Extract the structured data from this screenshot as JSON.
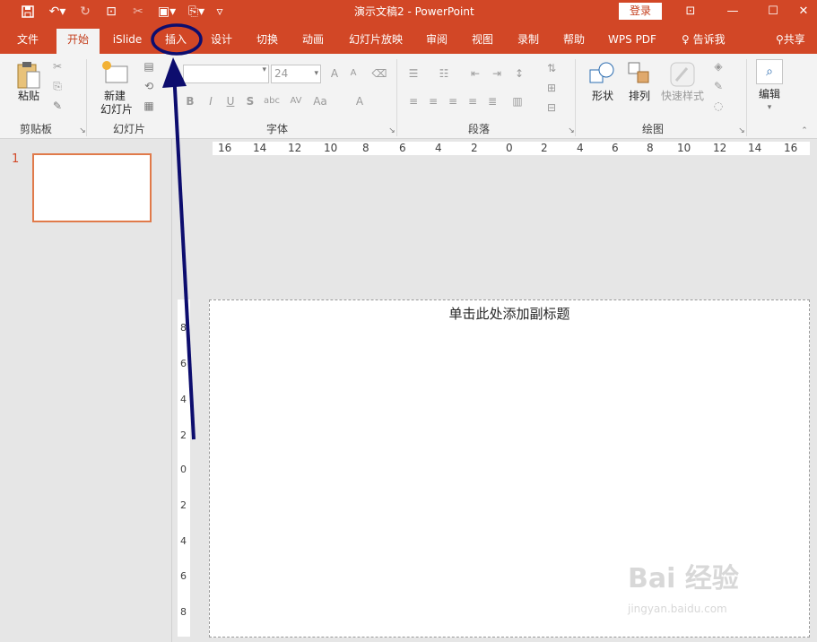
{
  "window": {
    "title": "演示文稿2 - PowerPoint",
    "login_label": "登录"
  },
  "qat": {
    "save_icon": "save-icon",
    "undo_icon": "undo-icon",
    "redo_icon": "redo-icon"
  },
  "tabs": [
    {
      "label": "文件"
    },
    {
      "label": "开始"
    },
    {
      "label": "iSlide"
    },
    {
      "label": "插入"
    },
    {
      "label": "设计"
    },
    {
      "label": "切换"
    },
    {
      "label": "动画"
    },
    {
      "label": "幻灯片放映"
    },
    {
      "label": "审阅"
    },
    {
      "label": "视图"
    },
    {
      "label": "录制"
    },
    {
      "label": "帮助"
    },
    {
      "label": "WPS PDF"
    }
  ],
  "tell_me": "告诉我",
  "share": "共享",
  "ribbon": {
    "clipboard": {
      "paste_label": "粘贴",
      "group_label": "剪贴板"
    },
    "slides": {
      "new_slide_line1": "新建",
      "new_slide_line2": "幻灯片",
      "group_label": "幻灯片"
    },
    "font": {
      "font_name": "",
      "font_size": "24",
      "bold": "B",
      "italic": "I",
      "underline": "U",
      "shadow": "S",
      "strike": "abc",
      "spacing": "AV",
      "case": "Aa",
      "color": "A",
      "grow": "A",
      "shrink": "A",
      "group_label": "字体"
    },
    "paragraph": {
      "group_label": "段落"
    },
    "drawing": {
      "shapes_label": "形状",
      "arrange_label": "排列",
      "quick_styles_label": "快速样式",
      "group_label": "绘图"
    },
    "editing": {
      "label": "编辑"
    }
  },
  "slide_panel": {
    "slide_number": "1"
  },
  "ruler": {
    "h_ticks": [
      "16",
      "14",
      "12",
      "10",
      "8",
      "6",
      "4",
      "2",
      "0",
      "2",
      "4",
      "6",
      "8",
      "10",
      "12",
      "14",
      "16"
    ],
    "v_ticks": [
      "8",
      "6",
      "4",
      "2",
      "0",
      "2",
      "4",
      "6",
      "8"
    ]
  },
  "slide": {
    "subtitle_placeholder": "单击此处添加副标题"
  },
  "watermark": {
    "text": "Bai 经验",
    "url_text": "jingyan.baidu.com"
  },
  "colors": {
    "accent": "#d24726",
    "annotation": "#0d0d6e"
  }
}
